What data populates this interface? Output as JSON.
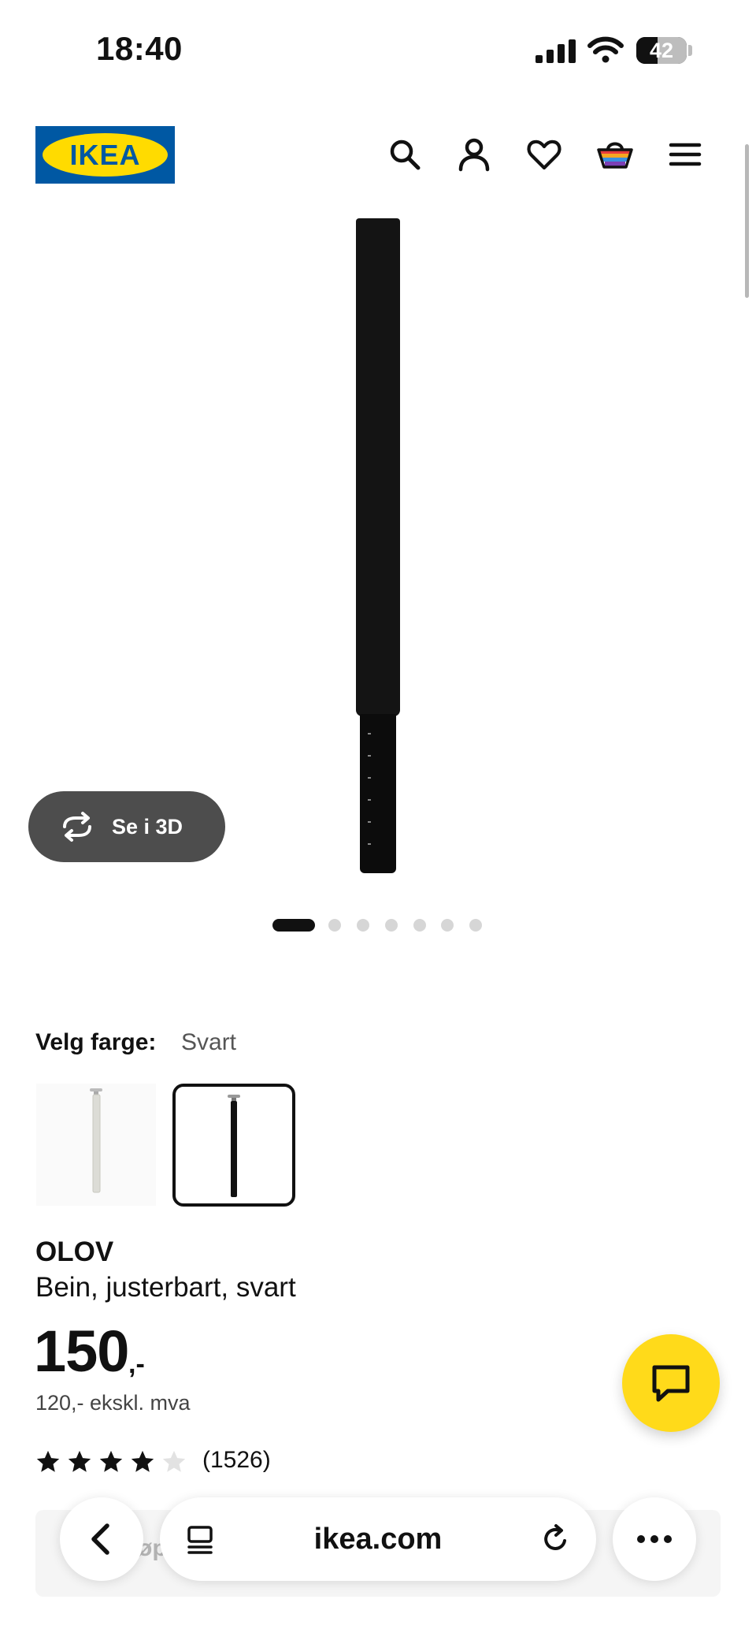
{
  "status_bar": {
    "time": "18:40",
    "battery": "42"
  },
  "header": {
    "logo_text": "IKEA",
    "icons": [
      "search-icon",
      "account-icon",
      "heart-icon",
      "basket-icon",
      "menu-icon"
    ]
  },
  "gallery": {
    "view_3d_label": "Se i 3D",
    "dot_count": 7,
    "active_dot": 1
  },
  "color_select": {
    "label": "Velg farge:",
    "value": "Svart"
  },
  "product": {
    "name": "OLOV",
    "description": "Bein, justerbart, svart",
    "price": "150",
    "price_suffix": ",-",
    "price_ex_vat": "120,- ekskl. mva",
    "rating": 4,
    "rating_max": 5,
    "review_count": "(1526)"
  },
  "browser": {
    "url": "ikea.com",
    "hidden_text": "øp"
  },
  "colors": {
    "brand_blue": "#0058a3",
    "brand_yellow": "#ffdb00",
    "chat_yellow": "#ffda1a"
  }
}
